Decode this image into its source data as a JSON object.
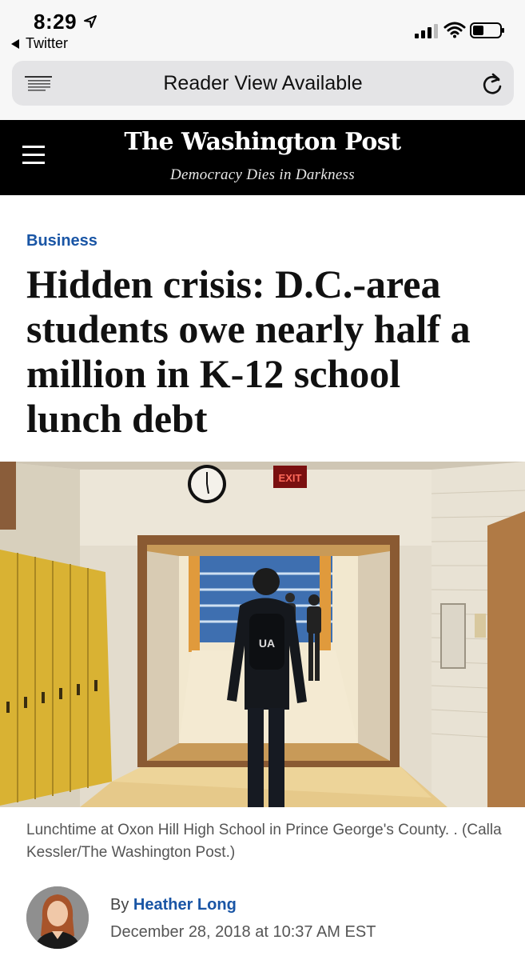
{
  "status_bar": {
    "time": "8:29",
    "back_app": "Twitter"
  },
  "browser": {
    "reader_text": "Reader View Available",
    "icons": [
      "reader-lines-icon",
      "reload-icon"
    ]
  },
  "site": {
    "masthead": "The Washington Post",
    "tagline": "Democracy Dies in Darkness",
    "background": "#000000"
  },
  "article": {
    "section": "Business",
    "headline": "Hidden crisis: D.C.-area students owe nearly half a million in K-12 school lunch debt",
    "photo_caption": "Lunchtime at Oxon Hill High School in Prince George's County. . (Calla Kessler/The Washington Post.)",
    "byline_prefix": "By",
    "author": "Heather Long",
    "dateline": "December 28, 2018 at 10:37 AM EST",
    "accent_color": "#1955a5",
    "photo_exit_sign": "EXIT"
  }
}
